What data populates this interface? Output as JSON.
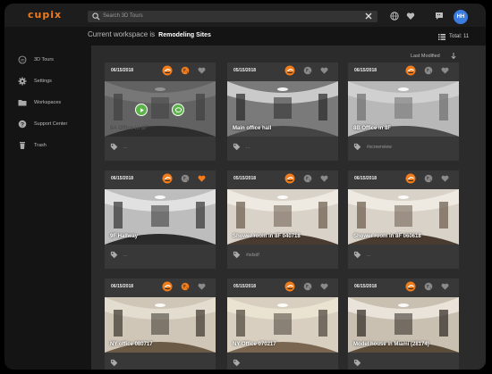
{
  "app": {
    "logo": "cupix",
    "brand_color": "#f07c1c",
    "accent_blue": "#3b7de0"
  },
  "search": {
    "placeholder": "Search 3D Tours"
  },
  "user": {
    "initials": "HH"
  },
  "workspace": {
    "prefix": "Current workspace is",
    "name": "Remodeling Sites",
    "total": "Total: 11"
  },
  "sort": {
    "label": "Last Modified"
  },
  "sidebar": {
    "items": [
      {
        "label": "3D Tours",
        "icon": "3d-tour-icon"
      },
      {
        "label": "Settings",
        "icon": "gear-icon"
      },
      {
        "label": "Workspaces",
        "icon": "folder-icon"
      },
      {
        "label": "Support Center",
        "icon": "help-icon"
      },
      {
        "label": "Trash",
        "icon": "trash-icon"
      }
    ]
  },
  "cards": [
    {
      "date": "06/15/2018",
      "title": "8A Office in 8F",
      "tag": "...",
      "favorite": false,
      "dimmed": true,
      "scene": "office-a"
    },
    {
      "date": "05/15/2018",
      "title": "Main office hall",
      "tag": "...",
      "favorite": false,
      "dimmed": false,
      "scene": "hall"
    },
    {
      "date": "06/15/2018",
      "title": "8B Office in 8F",
      "tag": "#screenview",
      "favorite": false,
      "dimmed": false,
      "scene": "office-b"
    },
    {
      "date": "06/15/2018",
      "title": "9F Hallway",
      "tag": "...",
      "favorite": true,
      "dimmed": false,
      "scene": "hallway"
    },
    {
      "date": "05/15/2018",
      "title": "Shower room in 8F 040718",
      "tag": "#sdsdf",
      "favorite": false,
      "dimmed": false,
      "scene": "room"
    },
    {
      "date": "06/15/2018",
      "title": "Shower room in 8F 060618",
      "tag": "...",
      "favorite": false,
      "dimmed": false,
      "scene": "room"
    },
    {
      "date": "06/15/2018",
      "title": "NY office 080717",
      "tag": "",
      "favorite": false,
      "dimmed": false,
      "scene": "ny"
    },
    {
      "date": "05/15/2018",
      "title": "NY Office 070217",
      "tag": "",
      "favorite": false,
      "dimmed": false,
      "scene": "ny2"
    },
    {
      "date": "06/15/2018",
      "title": "Model house in Miami (28174)",
      "tag": "",
      "favorite": false,
      "dimmed": false,
      "scene": "miami"
    }
  ]
}
